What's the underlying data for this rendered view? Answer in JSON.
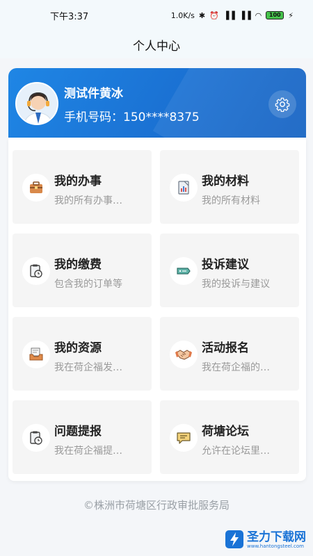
{
  "status_bar": {
    "time": "下午3:37",
    "network_speed": "1.0K/s",
    "battery": "100"
  },
  "nav": {
    "title": "个人中心"
  },
  "profile": {
    "name": "测试件黄冰",
    "phone": "手机号码：150****8375"
  },
  "menu": [
    {
      "title": "我的办事",
      "subtitle": "我的所有办事…",
      "icon": "briefcase-icon"
    },
    {
      "title": "我的材料",
      "subtitle": "我的所有材料",
      "icon": "document-chart-icon"
    },
    {
      "title": "我的缴费",
      "subtitle": "包含我的订单等",
      "icon": "clipboard-clock-icon"
    },
    {
      "title": "投诉建议",
      "subtitle": "我的投诉与建议",
      "icon": "ticket-icon"
    },
    {
      "title": "我的资源",
      "subtitle": "我在荷企福发…",
      "icon": "inbox-icon"
    },
    {
      "title": "活动报名",
      "subtitle": "我在荷企福的…",
      "icon": "handshake-icon"
    },
    {
      "title": "问题提报",
      "subtitle": "我在荷企福提…",
      "icon": "clipboard-clock-icon"
    },
    {
      "title": "荷塘论坛",
      "subtitle": "允许在论坛里…",
      "icon": "chat-bubble-icon"
    }
  ],
  "footer": {
    "text": "©株洲市荷塘区行政审批服务局"
  },
  "watermark": {
    "text": "圣力下载网",
    "url": "www.hantongsteel.com"
  },
  "colors": {
    "header_blue": "#1a6fd1",
    "tile_bg": "#f5f5f5",
    "subtitle_gray": "#9a9a9a"
  }
}
